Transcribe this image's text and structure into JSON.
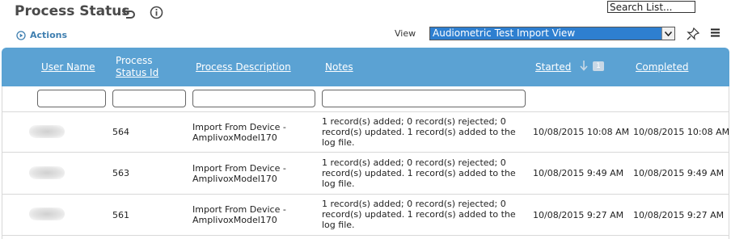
{
  "header": {
    "title": "Process Status",
    "search_value": "Search List...",
    "actions_label": "Actions",
    "view_label": "View",
    "view_selected": "Audiometric Test Import View"
  },
  "columns": {
    "user_name": "User Name",
    "process_status_id_line1": "Process",
    "process_status_id_line2": "Status Id",
    "process_description": "Process Description",
    "notes": "Notes",
    "started": "Started",
    "started_sort_rank": "1",
    "completed": "Completed"
  },
  "rows": [
    {
      "id": "564",
      "description_line1": "Import From Device -",
      "description_line2": "AmplivoxModel170",
      "notes_line1": "1 record(s) added; 0 record(s) rejected; 0",
      "notes_line2": "record(s) updated. 1 record(s) added to the",
      "notes_line3": "log file.",
      "started": "10/08/2015 10:08 AM",
      "completed": "10/08/2015 10:08 AM"
    },
    {
      "id": "563",
      "description_line1": "Import From Device -",
      "description_line2": "AmplivoxModel170",
      "notes_line1": "1 record(s) added; 0 record(s) rejected; 0",
      "notes_line2": "record(s) updated. 1 record(s) added to the",
      "notes_line3": "log file.",
      "started": "10/08/2015 9:49 AM",
      "completed": "10/08/2015 9:49 AM"
    },
    {
      "id": "561",
      "description_line1": "Import From Device -",
      "description_line2": "AmplivoxModel170",
      "notes_line1": "1 record(s) added; 0 record(s) rejected; 0",
      "notes_line2": "record(s) updated. 1 record(s) added to the",
      "notes_line3": "log file.",
      "started": "10/08/2015 9:27 AM",
      "completed": "10/08/2015 9:27 AM"
    }
  ],
  "colors": {
    "header_bg": "#5ba2d3",
    "accent": "#3f7fb0",
    "select_bg": "#2e7fd0"
  },
  "icons": [
    "back-icon",
    "info-icon",
    "actions-play-icon",
    "chevron-down-icon",
    "pin-icon",
    "menu-icon",
    "sort-down-icon"
  ]
}
